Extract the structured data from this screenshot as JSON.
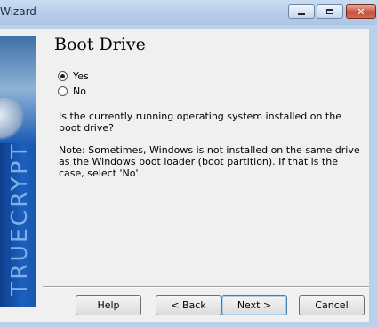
{
  "window": {
    "title": "Wizard",
    "controls": {
      "minimize": "minimize-icon",
      "maximize": "maximize-icon",
      "close": "close-icon"
    }
  },
  "banner": {
    "text": "TRUECRYPT"
  },
  "page": {
    "heading": "Boot Drive",
    "options": [
      {
        "label": "Yes",
        "checked": true
      },
      {
        "label": "No",
        "checked": false
      }
    ],
    "question": "Is the currently running operating system installed on the boot drive?",
    "note": "Note: Sometimes, Windows is not installed on the same drive as the Windows boot loader (boot partition). If that is the case, select 'No'."
  },
  "buttons": {
    "help": "Help",
    "back": "< Back",
    "next": "Next >",
    "cancel": "Cancel"
  },
  "colors": {
    "banner": "#1b5fbf",
    "titlebar": "#b7cde8",
    "close_button": "#c4513d"
  }
}
